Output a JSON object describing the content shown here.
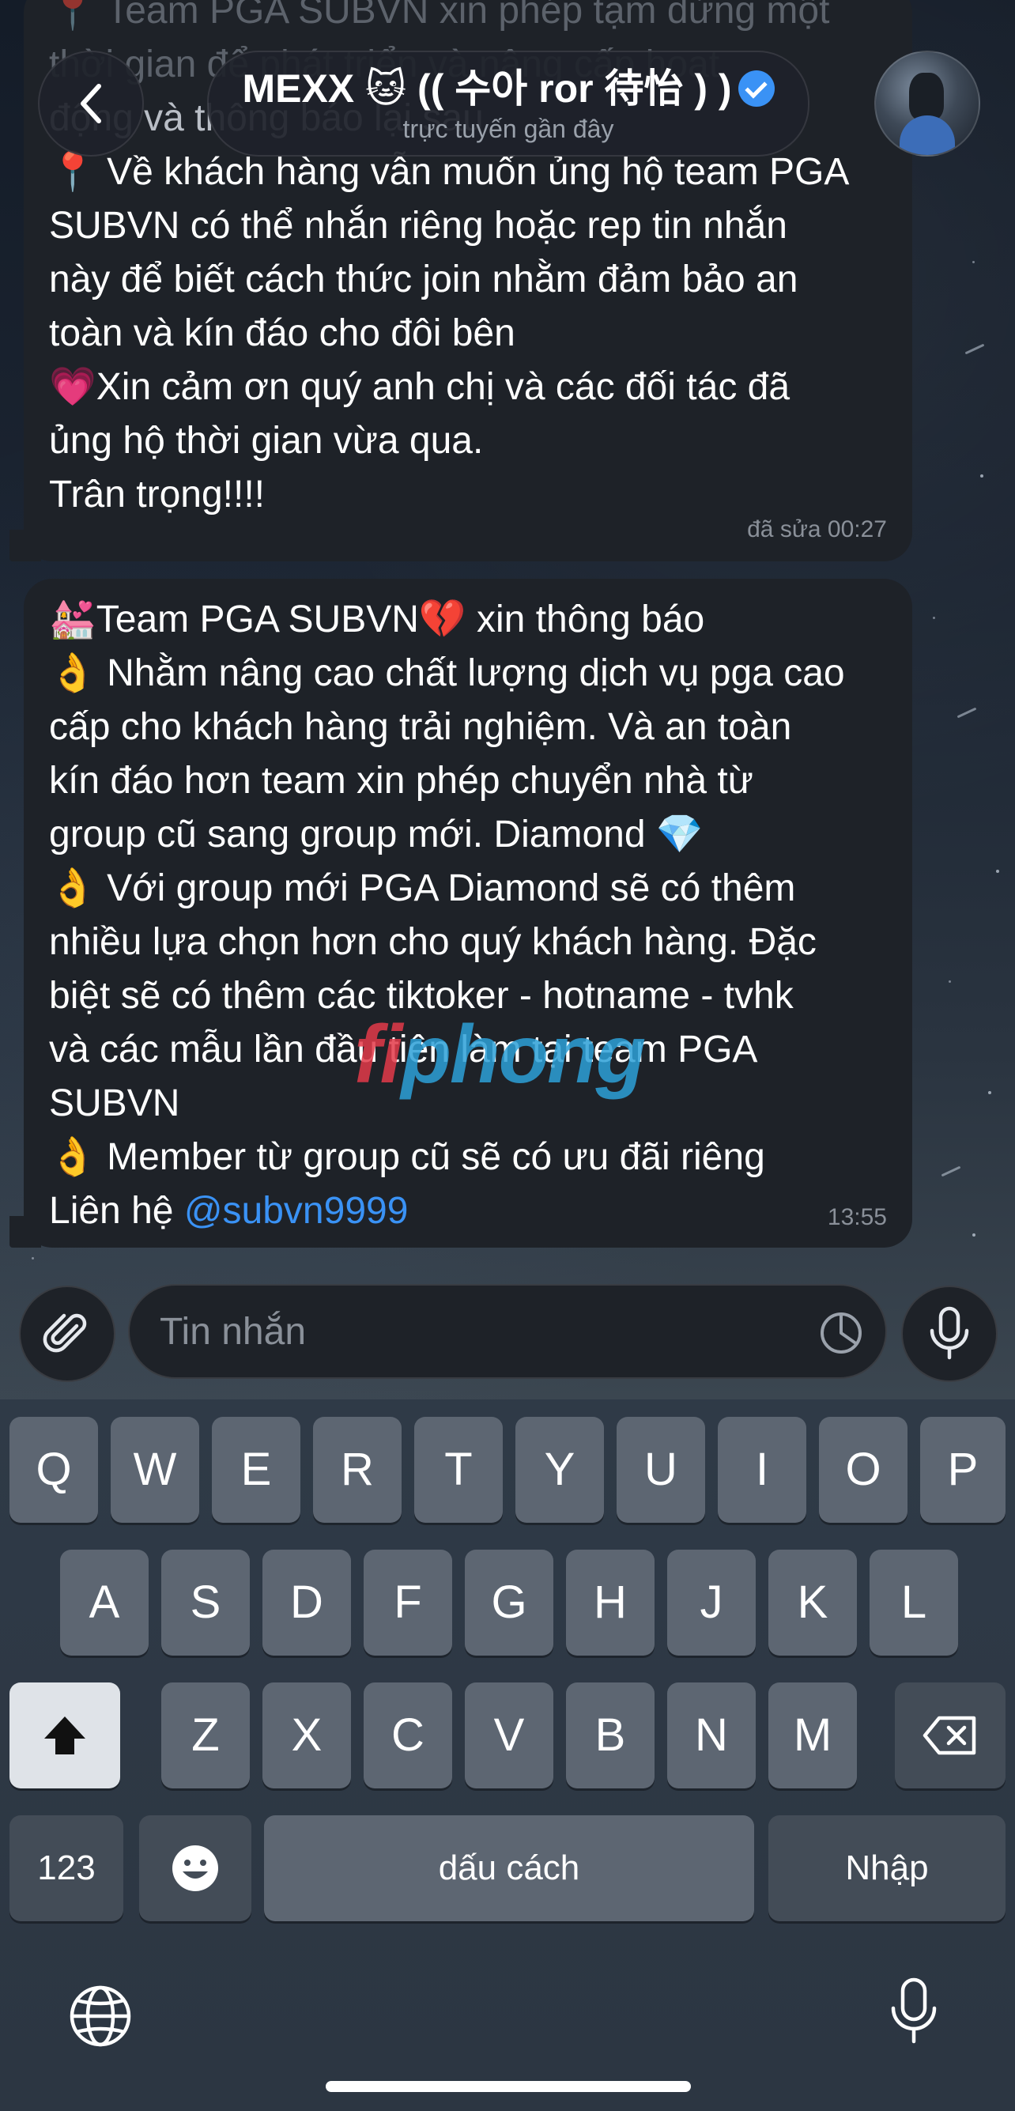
{
  "header": {
    "contact_name": "MEXX 🐱 (( 수아 ror 待怡 ) )",
    "status": "trực tuyến gần đây"
  },
  "messages": [
    {
      "overflow_text": "📍 Team PGA SUBVN xin phép tạm dừng một",
      "overflow_text2": "thời gian để phát triển và nâng cấp hoạt",
      "lines": [
        "động và thông báo lại sau",
        "📍 Về khách hàng vẫn muốn ủng hộ team PGA",
        "SUBVN có thể nhắn riêng hoặc rep tin nhắn",
        "này để biết cách thức join nhằm đảm bảo an",
        "toàn và kín đáo cho đôi bên",
        "💗Xin cảm ơn quý anh chị và các đối tác đã",
        "ủng hộ thời gian vừa qua.",
        "Trân trọng!!!!"
      ],
      "meta": "đã sửa 00:27"
    },
    {
      "lines": [
        "💒Team PGA SUBVN💔 xin thông báo",
        "👌 Nhằm nâng cao chất lượng dịch vụ pga cao",
        "cấp cho khách hàng trải nghiệm. Và an toàn",
        "kín đáo hơn team xin phép chuyển nhà từ",
        "group cũ sang group mới. Diamond 💎",
        "👌 Với group mới PGA Diamond  sẽ có thêm",
        "nhiều lựa chọn hơn cho quý khách hàng. Đặc",
        "biệt sẽ có thêm các tiktoker - hotname - tvhk",
        "và các mẫu lần đầu tiên làm tại team PGA",
        "SUBVN",
        "👌 Member từ group cũ sẽ có ưu đãi riêng"
      ],
      "contact_prefix": "Liên hệ ",
      "mention": "@subvn9999",
      "meta": "13:55"
    }
  ],
  "watermark": {
    "part1": "fi",
    "part2": "phong"
  },
  "composer": {
    "placeholder": "Tin nhắn"
  },
  "keyboard": {
    "row1": [
      "Q",
      "W",
      "E",
      "R",
      "T",
      "Y",
      "U",
      "I",
      "O",
      "P"
    ],
    "row2": [
      "A",
      "S",
      "D",
      "F",
      "G",
      "H",
      "J",
      "K",
      "L"
    ],
    "row3": [
      "Z",
      "X",
      "C",
      "V",
      "B",
      "N",
      "M"
    ],
    "numbers_label": "123",
    "space_label": "dấu cách",
    "return_label": "Nhập"
  },
  "icons": {
    "back": "chevron-left-icon",
    "verified": "verified-badge-icon",
    "attach": "paperclip-icon",
    "sticker": "sticker-icon",
    "mic": "microphone-icon",
    "shift": "shift-icon",
    "backspace": "backspace-icon",
    "emoji": "emoji-icon",
    "globe": "globe-icon",
    "dictation": "dictation-mic-icon"
  },
  "colors": {
    "accent": "#3a92f5",
    "bubble": "#1e2228",
    "meta": "#8a9099"
  }
}
